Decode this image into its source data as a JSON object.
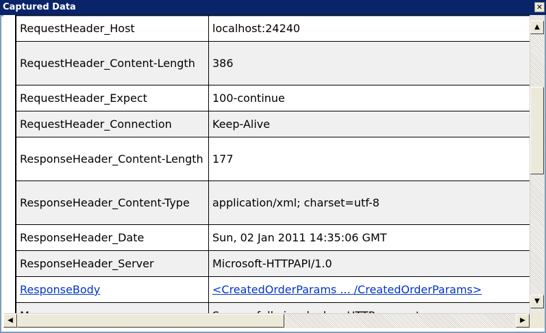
{
  "window": {
    "title": "Captured Data",
    "close_glyph": "✕"
  },
  "rows": [
    {
      "key": "RequestHeader_Host",
      "value": "localhost:24240"
    },
    {
      "key": "RequestHeader_Content-Length",
      "value": "386"
    },
    {
      "key": "RequestHeader_Expect",
      "value": "100-continue"
    },
    {
      "key": "RequestHeader_Connection",
      "value": "Keep-Alive"
    },
    {
      "key": "ResponseHeader_Content-Length",
      "value": "177"
    },
    {
      "key": "ResponseHeader_Content-Type",
      "value": "application/xml; charset=utf-8"
    },
    {
      "key": "ResponseHeader_Date",
      "value": "Sun, 02 Jan 2011 14:35:06 GMT"
    },
    {
      "key": "ResponseHeader_Server",
      "value": "Microsoft-HTTPAPI/1.0"
    },
    {
      "key": "ResponseBody",
      "value": "<CreatedOrderParams ... /CreatedOrderParams>"
    },
    {
      "key": "Message",
      "value": "Successfully invoked an HTTP request"
    }
  ],
  "scrollbar": {
    "up_glyph": "▲",
    "down_glyph": "▼",
    "left_glyph": "◀",
    "right_glyph": "▶"
  },
  "icons": {
    "close": "close-icon",
    "up": "arrow-up-icon",
    "down": "arrow-down-icon",
    "left": "arrow-left-icon",
    "right": "arrow-right-icon"
  },
  "colors": {
    "titlebar": "#0a246a",
    "link": "#0033cc"
  }
}
